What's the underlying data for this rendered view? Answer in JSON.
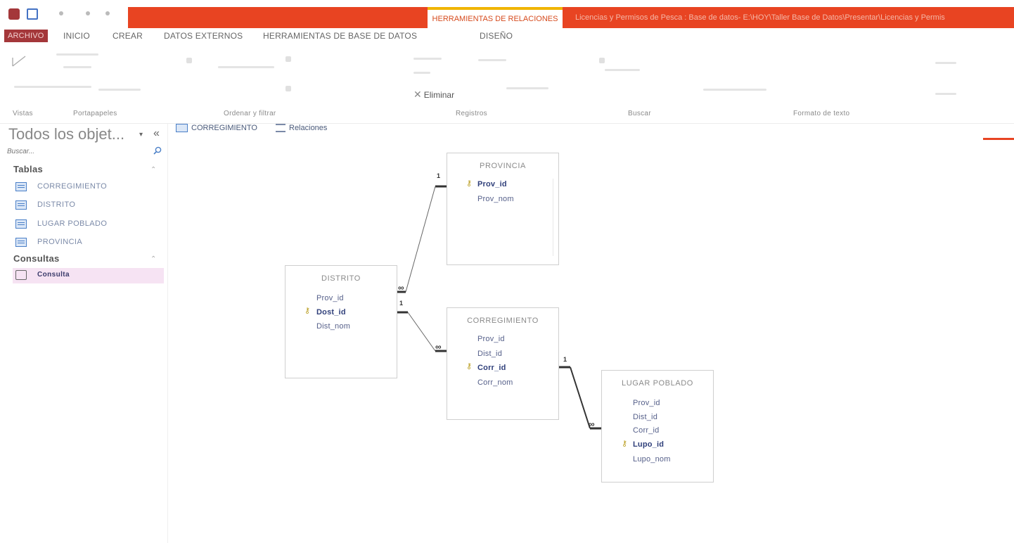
{
  "title_bar": {
    "context_tab_label": "HERRAMIENTAS DE RELACIONES",
    "path_text": "Licencias y Permisos de Pesca : Base de datos- E:\\HOY\\Taller Base de Datos\\Presentar\\Licencias y Permis"
  },
  "ribbon_tabs": [
    "ARCHIVO",
    "INICIO",
    "CREAR",
    "DATOS EXTERNOS",
    "HERRAMIENTAS DE BASE DE DATOS",
    "DISEÑO"
  ],
  "ribbon": {
    "eliminar_label": "Eliminar",
    "groups": [
      "Vistas",
      "Portapapeles",
      "Ordenar y filtrar",
      "Registros",
      "Buscar",
      "Formato de texto"
    ]
  },
  "nav": {
    "title": "Todos los objet...",
    "search_placeholder": "Buscar...",
    "sections": [
      {
        "label": "Tablas",
        "items": [
          "CORREGIMIENTO",
          "DISTRITO",
          "LUGAR POBLADO",
          "PROVINCIA"
        ]
      },
      {
        "label": "Consultas",
        "items": [
          "Consulta"
        ]
      }
    ]
  },
  "doc_tabs": [
    "CORREGIMIENTO",
    "Relaciones"
  ],
  "tables": {
    "provincia": {
      "name": "PROVINCIA",
      "fields": [
        "Prov_id",
        "Prov_nom"
      ],
      "key_field": "Prov_id"
    },
    "distrito": {
      "name": "DISTRITO",
      "fields": [
        "Prov_id",
        "Dost_id",
        "Dist_nom"
      ],
      "key_field": "Dost_id"
    },
    "corregimiento": {
      "name": "CORREGIMIENTO",
      "fields": [
        "Prov_id",
        "Dist_id",
        "Corr_id",
        "Corr_nom"
      ],
      "key_field": "Corr_id"
    },
    "lugar_poblado": {
      "name": "LUGAR POBLADO",
      "fields": [
        "Prov_id",
        "Dist_id",
        "Corr_id",
        "Lupo_id",
        "Lupo_nom"
      ],
      "key_field": "Lupo_id"
    }
  },
  "relationships": [
    {
      "from": "PROVINCIA",
      "to": "DISTRITO",
      "one_label": "1",
      "many_label": "∞"
    },
    {
      "from": "DISTRITO",
      "to": "CORREGIMIENTO",
      "one_label": "1",
      "many_label": "∞"
    },
    {
      "from": "CORREGIMIENTO",
      "to": "LUGAR POBLADO",
      "one_label": "1",
      "many_label": "∞"
    }
  ],
  "colors": {
    "title_band": "#e84422",
    "context_accent": "#f0b400",
    "file_tab": "#a4373a",
    "relationship_line": "#333333"
  }
}
